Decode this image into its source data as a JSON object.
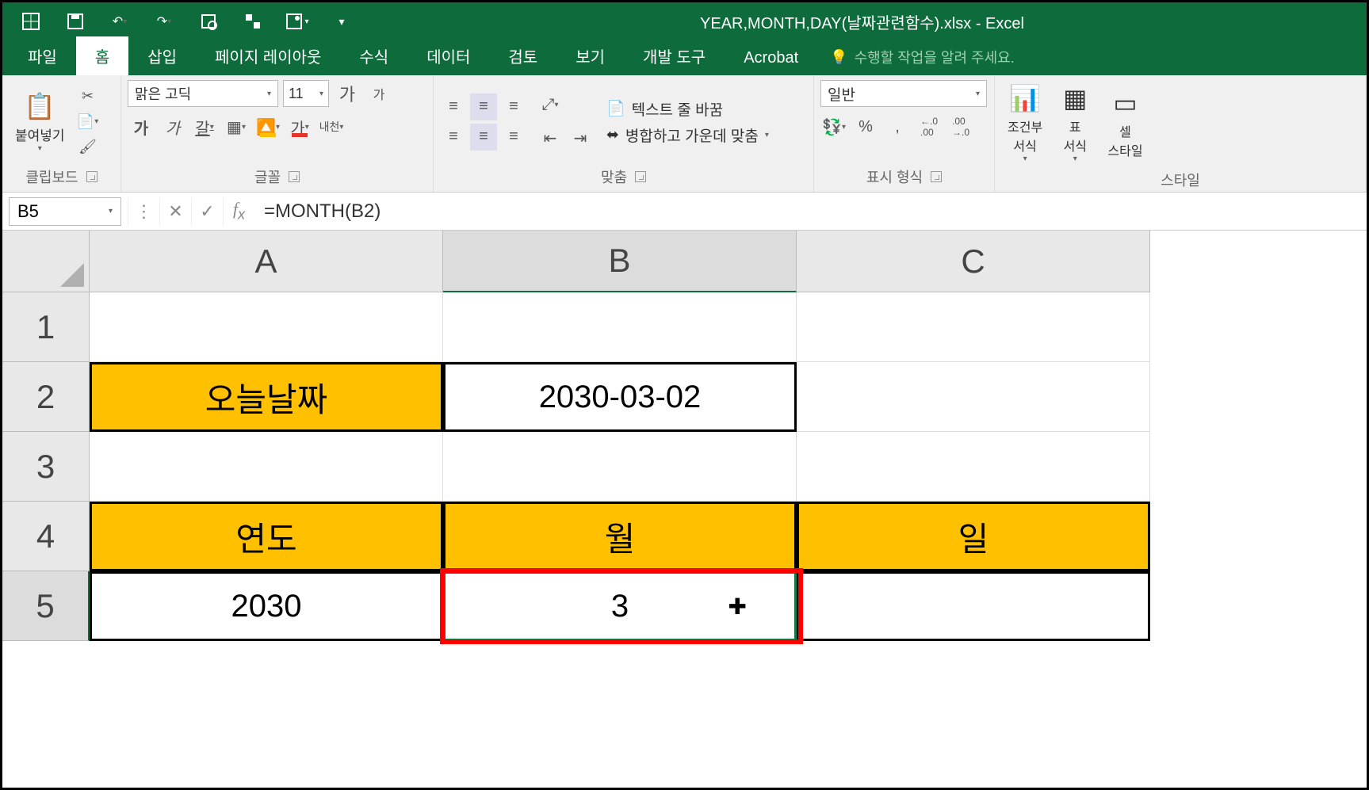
{
  "titlebar": {
    "title": "YEAR,MONTH,DAY(날짜관련함수).xlsx - Excel"
  },
  "tabs": {
    "file": "파일",
    "home": "홈",
    "insert": "삽입",
    "page_layout": "페이지 레이아웃",
    "formulas": "수식",
    "data": "데이터",
    "review": "검토",
    "view": "보기",
    "developer": "개발 도구",
    "acrobat": "Acrobat",
    "tell_me": "수행할 작업을 알려 주세요."
  },
  "ribbon": {
    "clipboard": {
      "paste": "붙여넣기",
      "label": "클립보드"
    },
    "font": {
      "name": "맑은 고딕",
      "size": "11",
      "increase": "가",
      "decrease": "가",
      "bold": "가",
      "italic": "가",
      "underline": "갈",
      "fill": "ᴬ",
      "color": "가",
      "hanja": "내천",
      "label": "글꼴"
    },
    "alignment": {
      "wrap": "텍스트 줄 바꿈",
      "merge": "병합하고 가운데 맞춤",
      "label": "맞춤"
    },
    "number": {
      "format": "일반",
      "percent": "%",
      "comma": ",",
      "inc_dec": "←.0",
      "dec_dec": ".00→",
      "label": "표시 형식"
    },
    "styles": {
      "conditional": "조건부\n서식",
      "table": "표\n서식",
      "cell": "셀\n스타일",
      "label": "스타일"
    }
  },
  "formula_bar": {
    "name_box": "B5",
    "formula": "=MONTH(B2)"
  },
  "grid": {
    "columns": [
      "A",
      "B",
      "C"
    ],
    "rows": [
      "1",
      "2",
      "3",
      "4",
      "5"
    ],
    "cells": {
      "A2": "오늘날짜",
      "B2": "2030-03-02",
      "A4": "연도",
      "B4": "월",
      "C4": "일",
      "A5": "2030",
      "B5": "3"
    }
  },
  "chart_data": null
}
